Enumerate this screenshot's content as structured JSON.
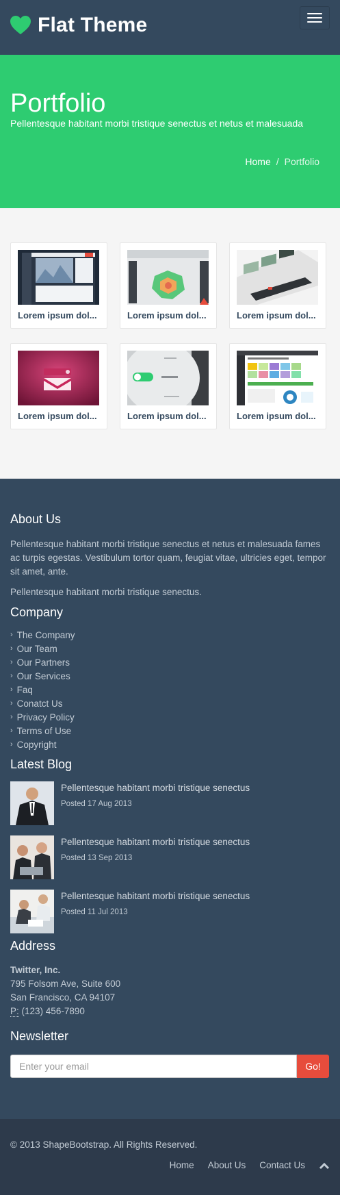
{
  "navbar": {
    "brand": "Flat Theme",
    "toggle_icon": "hamburger-menu-icon",
    "brand_color": "#2ecc71"
  },
  "title_section": {
    "title": "Portfolio",
    "subtitle": "Pellentesque habitant morbi tristique senectus et netus et malesuada",
    "breadcrumb": {
      "home": "Home",
      "separator": "/",
      "current": "Portfolio"
    }
  },
  "portfolio": {
    "items": [
      {
        "caption": "Lorem ipsum dol..."
      },
      {
        "caption": "Lorem ipsum dol..."
      },
      {
        "caption": "Lorem ipsum dol..."
      },
      {
        "caption": "Lorem ipsum dol..."
      },
      {
        "caption": "Lorem ipsum dol..."
      },
      {
        "caption": "Lorem ipsum dol..."
      }
    ]
  },
  "about": {
    "heading": "About Us",
    "p1": "Pellentesque habitant morbi tristique senectus et netus et malesuada fames ac turpis egestas. Vestibulum tortor quam, feugiat vitae, ultricies eget, tempor sit amet, ante.",
    "p2": "Pellentesque habitant morbi tristique senectus."
  },
  "company": {
    "heading": "Company",
    "links": [
      "The Company",
      "Our Team",
      "Our Partners",
      "Our Services",
      "Faq",
      "Conatct Us",
      "Privacy Policy",
      "Terms of Use",
      "Copyright"
    ]
  },
  "blog": {
    "heading": "Latest Blog",
    "posts": [
      {
        "title": "Pellentesque habitant morbi tristique senectus",
        "date": "Posted 17 Aug 2013"
      },
      {
        "title": "Pellentesque habitant morbi tristique senectus",
        "date": "Posted 13 Sep 2013"
      },
      {
        "title": "Pellentesque habitant morbi tristique senectus",
        "date": "Posted 11 Jul 2013"
      }
    ]
  },
  "address": {
    "heading": "Address",
    "company": "Twitter, Inc.",
    "line1": "795 Folsom Ave, Suite 600",
    "line2": "San Francisco, CA 94107",
    "phone_label": "P:",
    "phone": "(123) 456-7890"
  },
  "newsletter": {
    "heading": "Newsletter",
    "placeholder": "Enter your email",
    "button": "Go!",
    "button_color": "#e74c3c"
  },
  "footer": {
    "copyright": "© 2013 ShapeBootstrap. All Rights Reserved.",
    "links": [
      "Home",
      "About Us",
      "Contact Us"
    ],
    "top_icon": "chevron-up-icon"
  }
}
